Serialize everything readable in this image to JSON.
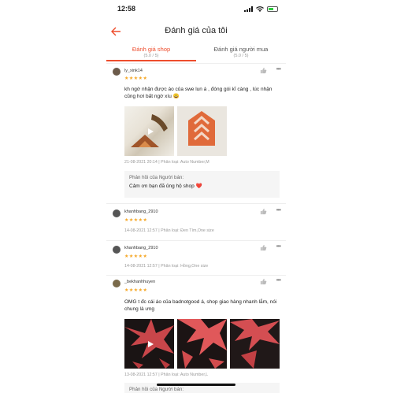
{
  "status": {
    "time": "12:58"
  },
  "header": {
    "title": "Đánh giá của tôi"
  },
  "tabs": [
    {
      "label": "Đánh giá shop",
      "sub": "(5.0 / 5)"
    },
    {
      "label": "Đánh giá người mua",
      "sub": "(5.0 / 5)"
    }
  ],
  "colors": {
    "accent": "#ee4d2d",
    "star": "#f5a623"
  },
  "reviews": [
    {
      "user": "ly_xink14",
      "stars": "★★★★★",
      "comment": "kh ngờ nhận được áo của swe lun á , đóng gói kĩ càng , lúc nhận cũng hơi bất ngờ xíu 😀",
      "meta": "21-08-2021 20:14 | Phân loại: Auto Number,M",
      "reply_title": "Phản hồi của Người bán:",
      "reply_body": "Cảm ơn bạn đã ủng hộ shop ❤️"
    },
    {
      "user": "khanhbang_2910",
      "stars": "★★★★★",
      "meta": "14-08-2021 12:57 | Phân loại: Đen Tím,One size"
    },
    {
      "user": "khanhbang_2910",
      "stars": "★★★★★",
      "meta": "14-08-2021 12:57 | Phân loại: Hồng,One size"
    },
    {
      "user": "_bekhanhhuyen",
      "stars": "★★★★★",
      "comment": "OMG t đc cái áo của badnotgood á, shop giao hàng nhanh lắm, nói chung là ưng",
      "meta": "13-08-2021 12:57 | Phân loại: Auto Number,L",
      "reply_title": "Phản hồi của Người bán:"
    }
  ],
  "icons": {
    "back": "back-arrow-icon",
    "like": "thumbs-up-icon",
    "more": "more-dots-icon",
    "play": "play-icon"
  }
}
